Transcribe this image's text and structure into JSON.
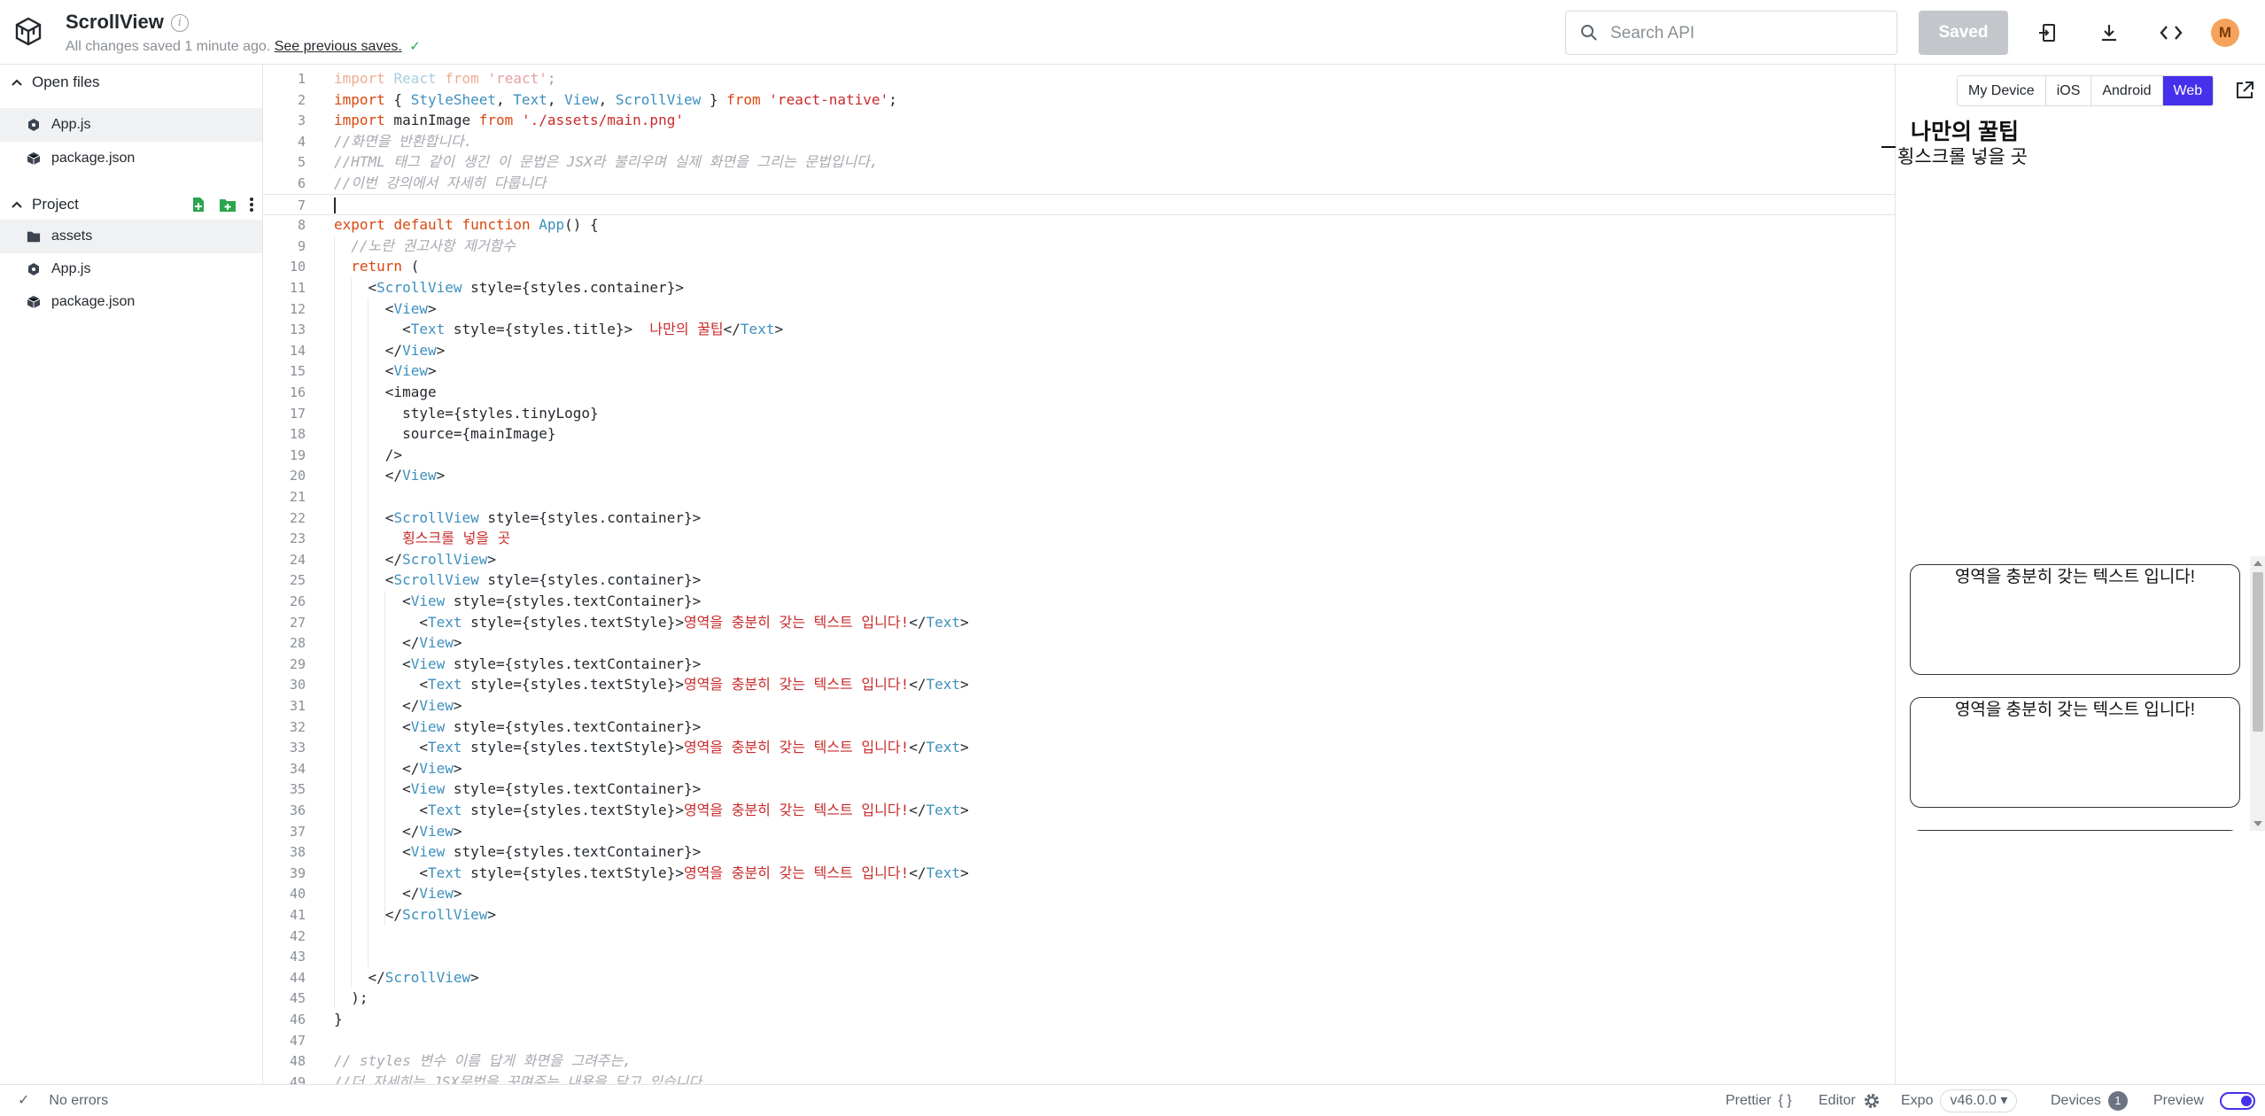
{
  "header": {
    "title": "ScrollView",
    "save_status": "All changes saved 1 minute ago.",
    "prev_saves_link": "See previous saves.",
    "search_placeholder": "Search API",
    "saved_button": "Saved",
    "avatar_initial": "M"
  },
  "sidebar": {
    "open_files_label": "Open files",
    "open_files": [
      "App.js",
      "package.json"
    ],
    "project_label": "Project",
    "project_files": [
      "assets",
      "App.js",
      "package.json"
    ]
  },
  "editor": {
    "current_line": 7,
    "lines": [
      "import React from 'react';",
      "import { StyleSheet, Text, View, ScrollView } from 'react-native';",
      "import mainImage from './assets/main.png'",
      "//화면을 반환합니다.",
      "//HTML 태그 같이 생긴 이 문법은 JSX라 불리우며 실제 화면을 그리는 문법입니다,",
      "//이번 강의에서 자세히 다룹니다",
      "",
      "export default function App() {",
      "  //노란 권고사항 제거함수",
      "  return (",
      "    <ScrollView style={styles.container}>",
      "      <View>",
      "        <Text style={styles.title}>  나만의 꿀팁</Text>",
      "      </View>",
      "      <View>",
      "      <image",
      "        style={styles.tinyLogo}",
      "        source={mainImage}",
      "      />",
      "      </View>",
      "",
      "      <ScrollView style={styles.container}>",
      "        횡스크롤 넣을 곳",
      "      </ScrollView>",
      "      <ScrollView style={styles.container}>",
      "        <View style={styles.textContainer}>",
      "          <Text style={styles.textStyle}>영역을 충분히 갖는 텍스트 입니다!</Text>",
      "        </View>",
      "        <View style={styles.textContainer}>",
      "          <Text style={styles.textStyle}>영역을 충분히 갖는 텍스트 입니다!</Text>",
      "        </View>",
      "        <View style={styles.textContainer}>",
      "          <Text style={styles.textStyle}>영역을 충분히 갖는 텍스트 입니다!</Text>",
      "        </View>",
      "        <View style={styles.textContainer}>",
      "          <Text style={styles.textStyle}>영역을 충분히 갖는 텍스트 입니다!</Text>",
      "        </View>",
      "        <View style={styles.textContainer}>",
      "          <Text style={styles.textStyle}>영역을 충분히 갖는 텍스트 입니다!</Text>",
      "        </View>",
      "      </ScrollView>",
      "",
      "",
      "    </ScrollView>",
      "  );",
      "}",
      "",
      "// styles 변수 이름 답게 화면을 그려주는,",
      "//더 자세히는 JSX문법을 꾸며주는 내용을 담고 있습니다."
    ]
  },
  "preview": {
    "tabs": [
      "My Device",
      "iOS",
      "Android",
      "Web"
    ],
    "active_tab": "Web",
    "title": "나만의 꿀팁",
    "subtitle": "횡스크롤 넣을 곳",
    "box_text": "영역을 충분히 갖는 텍스트 입니다!",
    "box_count": 3
  },
  "footer": {
    "errors": "No errors",
    "prettier": "Prettier",
    "prettier_glyph": "{ }",
    "editor": "Editor",
    "expo": "Expo",
    "expo_version": "v46.0.0 ▾",
    "devices": "Devices",
    "devices_count": "1",
    "preview": "Preview"
  },
  "colors": {
    "accent": "#4630eb",
    "keyword": "#d9480f",
    "string": "#c92a2a",
    "component": "#3d8fbd",
    "comment": "#a7aab0"
  }
}
